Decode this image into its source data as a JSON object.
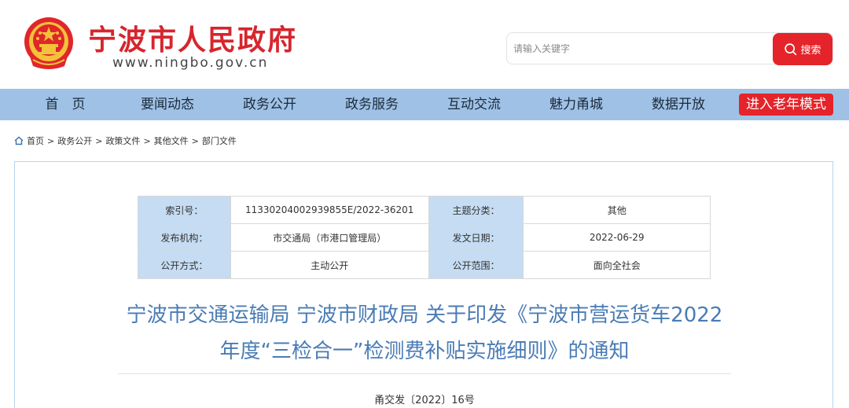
{
  "header": {
    "site_title": "宁波市人民政府",
    "site_url": "www.ningbo.gov.cn",
    "search": {
      "placeholder": "请输入关键字",
      "button_label": "搜索"
    }
  },
  "nav": {
    "items": [
      {
        "label": "首　页"
      },
      {
        "label": "要闻动态"
      },
      {
        "label": "政务公开"
      },
      {
        "label": "政务服务"
      },
      {
        "label": "互动交流"
      },
      {
        "label": "魅力甬城"
      },
      {
        "label": "数据开放"
      }
    ],
    "elder_mode_label": "进入老年模式"
  },
  "breadcrumb": {
    "items": [
      "首页",
      "政务公开",
      "政策文件",
      "其他文件",
      "部门文件"
    ],
    "separator": ">"
  },
  "meta": {
    "rows": [
      {
        "label1": "索引号：",
        "value1": "11330204002939855E/2022-36201",
        "label2": "主题分类：",
        "value2": "其他"
      },
      {
        "label1": "发布机构：",
        "value1": "市交通局（市港口管理局）",
        "label2": "发文日期：",
        "value2": "2022-06-29"
      },
      {
        "label1": "公开方式：",
        "value1": "主动公开",
        "label2": "公开范围：",
        "value2": "面向全社会"
      }
    ]
  },
  "document": {
    "title_line1": "宁波市交通运输局 宁波市财政局 关于印发《宁波市营运货车2022",
    "title_line2": "年度“三检合一”检测费补贴实施细则》的通知",
    "number": "甬交发〔2022〕16号"
  },
  "colors": {
    "brand_red": "#d7252d",
    "button_red": "#e4242a",
    "nav_blue": "#9fc1e6",
    "label_cell_blue": "#c5dcf2",
    "title_blue": "#4a7cb5"
  }
}
